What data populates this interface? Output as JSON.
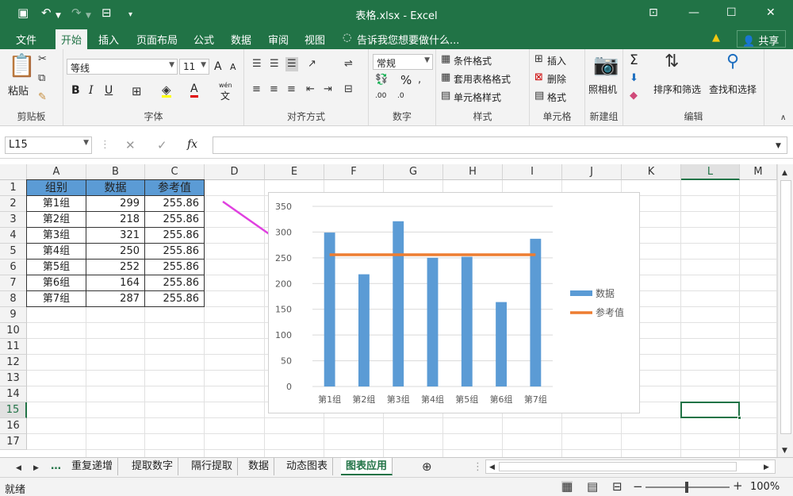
{
  "window": {
    "title": "表格.xlsx - Excel"
  },
  "ribbon_tabs": [
    "文件",
    "开始",
    "插入",
    "页面布局",
    "公式",
    "数据",
    "审阅",
    "视图"
  ],
  "tell_me": "告诉我您想要做什么...",
  "share_label": "共享",
  "ribbon": {
    "clipboard": {
      "paste": "粘贴",
      "label": "剪贴板"
    },
    "font": {
      "name": "等线",
      "size": "11",
      "label": "字体",
      "bold": "B",
      "italic": "I",
      "underline": "U",
      "grow": "A",
      "shrink": "A",
      "font_color": "A",
      "phonetic": "wén",
      "phonetic2": "文"
    },
    "alignment": {
      "label": "对齐方式"
    },
    "number": {
      "format": "常规",
      "percent": "%",
      "label": "数字",
      "dec_inc": ".00",
      "dec_dec": ".0"
    },
    "styles": {
      "conditional": "条件格式",
      "table": "套用表格格式",
      "cell": "单元格样式",
      "label": "样式"
    },
    "cells": {
      "insert": "插入",
      "delete": "删除",
      "format": "格式",
      "label": "单元格"
    },
    "camera": {
      "btn": "照相机",
      "label": "新建组"
    },
    "editing": {
      "sort": "排序和筛选",
      "find": "查找和选择",
      "label": "编辑",
      "sum": "Σ"
    }
  },
  "formula_bar": {
    "name_box": "L15",
    "fx": "fx",
    "value": ""
  },
  "columns": [
    "A",
    "B",
    "C",
    "D",
    "E",
    "F",
    "G",
    "H",
    "I",
    "J",
    "K",
    "L",
    "M"
  ],
  "rows": [
    "1",
    "2",
    "3",
    "4",
    "5",
    "6",
    "7",
    "8",
    "9",
    "10",
    "11",
    "12",
    "13",
    "14",
    "15",
    "16",
    "17"
  ],
  "table": {
    "headers": [
      "组别",
      "数据",
      "参考值"
    ],
    "rows": [
      [
        "第1组",
        "299",
        "255.86"
      ],
      [
        "第2组",
        "218",
        "255.86"
      ],
      [
        "第3组",
        "321",
        "255.86"
      ],
      [
        "第4组",
        "250",
        "255.86"
      ],
      [
        "第5组",
        "252",
        "255.86"
      ],
      [
        "第6组",
        "164",
        "255.86"
      ],
      [
        "第7组",
        "287",
        "255.86"
      ]
    ]
  },
  "chart_data": {
    "type": "bar",
    "categories": [
      "第1组",
      "第2组",
      "第3组",
      "第4组",
      "第5组",
      "第6组",
      "第7组"
    ],
    "series": [
      {
        "name": "数据",
        "type": "bar",
        "values": [
          299,
          218,
          321,
          250,
          252,
          164,
          287
        ],
        "color": "#5b9bd5"
      },
      {
        "name": "参考值",
        "type": "line",
        "values": [
          255.86,
          255.86,
          255.86,
          255.86,
          255.86,
          255.86,
          255.86
        ],
        "color": "#ed7d31"
      }
    ],
    "ylim": [
      0,
      350
    ],
    "yticks": [
      "0",
      "50",
      "100",
      "150",
      "200",
      "250",
      "300",
      "350"
    ],
    "grid": true,
    "legend": "right"
  },
  "sheet_tabs": [
    "重复递增",
    "提取数字",
    "隔行提取",
    "数据",
    "动态图表",
    "图表应用"
  ],
  "active_sheet": "图表应用",
  "status": {
    "ready": "就绪",
    "zoom": "100%"
  },
  "colors": {
    "accent": "#217346",
    "arrow": "#e040e0",
    "header_fill": "#5b9bd5"
  }
}
